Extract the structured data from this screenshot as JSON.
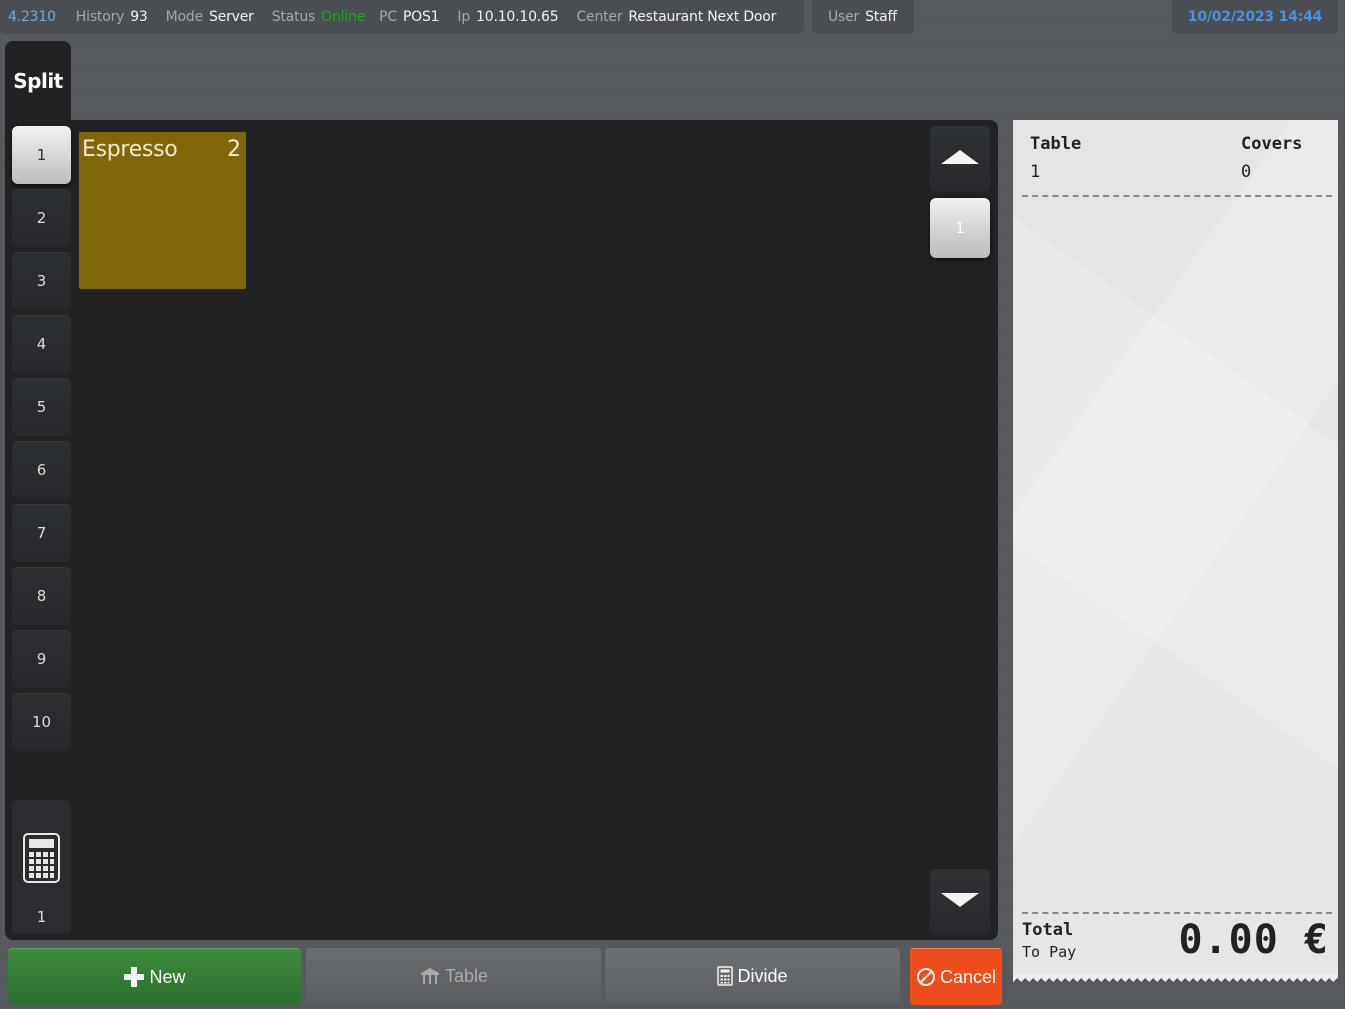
{
  "status_bar": {
    "version": "4.2310",
    "history_label": "History",
    "history_value": "93",
    "mode_label": "Mode",
    "mode_value": "Server",
    "status_label": "Status",
    "status_value": "Online",
    "pc_label": "PC",
    "pc_value": "POS1",
    "ip_label": "Ip",
    "ip_value": "10.10.10.65",
    "center_label": "Center",
    "center_value": "Restaurant Next Door",
    "user_label": "User",
    "user_value": "Staff",
    "datetime": "10/02/2023 14:44",
    "online_color": "#21a52a"
  },
  "split_tab": {
    "label": "Split"
  },
  "split_numbers": [
    "1",
    "2",
    "3",
    "4",
    "5",
    "6",
    "7",
    "8",
    "9",
    "10"
  ],
  "active_split": "1",
  "calculator": {
    "icon": "calculator-icon",
    "value": "1"
  },
  "items": [
    {
      "name": "Espresso",
      "qty": "2",
      "color": "#806608"
    }
  ],
  "pager": {
    "page": "1",
    "up_icon": "arrow-up-icon",
    "down_icon": "arrow-down-icon"
  },
  "receipt": {
    "table_label": "Table",
    "table_value": "1",
    "covers_label": "Covers",
    "covers_value": "0",
    "total_label": "Total",
    "to_pay_label": "To Pay",
    "total_amount": "0.00 €"
  },
  "buttons": {
    "new": {
      "label": "New",
      "icon": "plus-icon",
      "color": "#2f7a33"
    },
    "table": {
      "label": "Table",
      "icon": "table-icon"
    },
    "divide": {
      "label": "Divide",
      "icon": "calculator-icon"
    },
    "cancel": {
      "label": "Cancel",
      "icon": "cancel-icon",
      "color": "#ee4d1b"
    }
  }
}
